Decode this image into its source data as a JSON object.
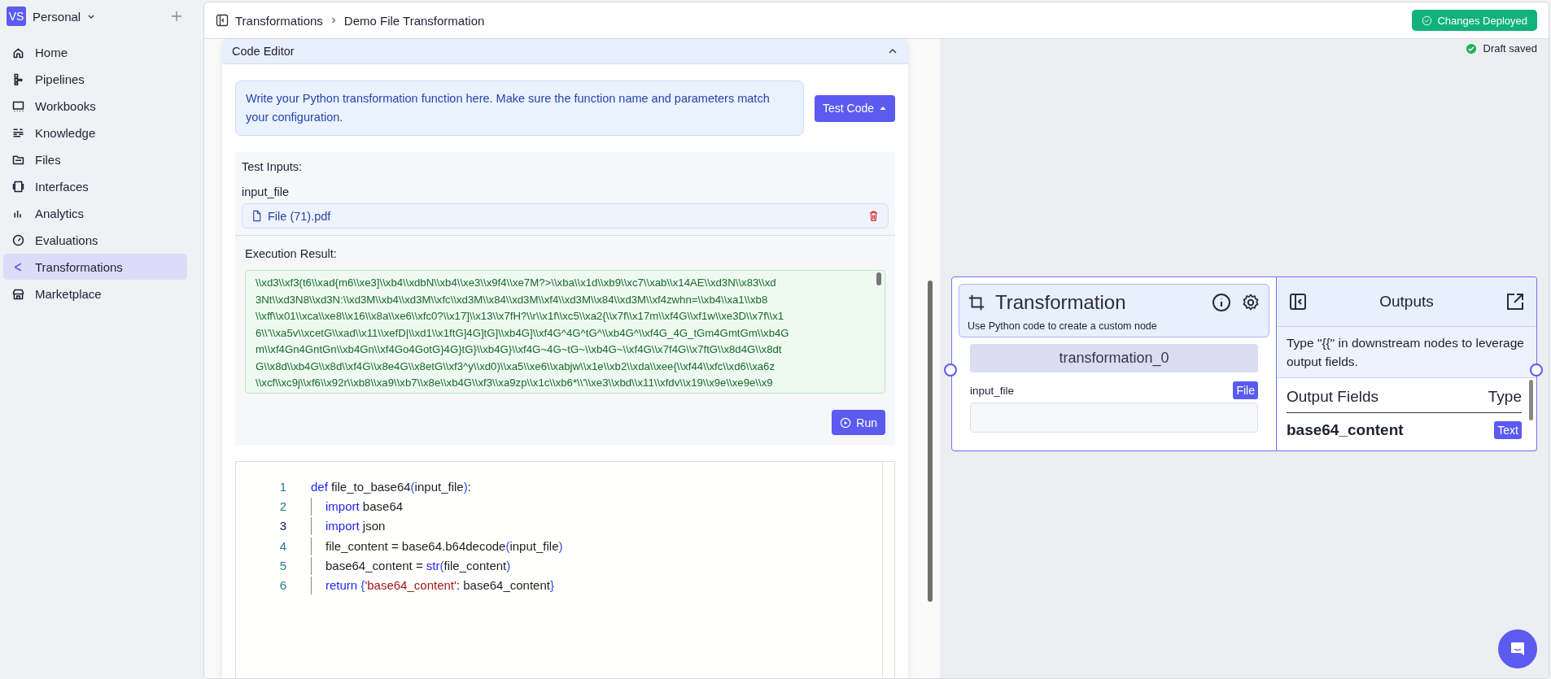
{
  "workspace": {
    "initials": "VS",
    "name": "Personal"
  },
  "sidebar": {
    "items": [
      {
        "label": "Home",
        "selected": false
      },
      {
        "label": "Pipelines",
        "selected": false
      },
      {
        "label": "Workbooks",
        "selected": false
      },
      {
        "label": "Knowledge",
        "selected": false
      },
      {
        "label": "Files",
        "selected": false
      },
      {
        "label": "Interfaces",
        "selected": false
      },
      {
        "label": "Analytics",
        "selected": false
      },
      {
        "label": "Evaluations",
        "selected": false
      },
      {
        "label": "Transformations",
        "selected": true
      },
      {
        "label": "Marketplace",
        "selected": false
      }
    ]
  },
  "breadcrumb": [
    "Transformations",
    "Demo File Transformation"
  ],
  "deploy_button": "Changes Deployed",
  "draft_status": "Draft saved",
  "code_editor": {
    "title": "Code Editor",
    "expanded": true,
    "info": "Write your Python transformation function here. Make sure the function name and parameters match your configuration.",
    "test_button": "Test Code",
    "test_inputs": {
      "title": "Test Inputs:",
      "field_label": "input_file",
      "file_name": "File (71).pdf"
    },
    "result": {
      "title": "Execution Result:",
      "lines": [
        "\\\\xd3\\\\xf3(t6\\\\xad{m6\\\\xe3]\\\\xb4\\\\xdbN\\\\xb4\\\\xe3\\\\x9f4\\\\xe7M?>\\\\xba\\\\x1d\\\\xb9\\\\xc7\\\\xab\\\\x14AE\\\\xd3N\\\\x83\\\\xd",
        "3Nt\\\\xd3N8\\\\xd3N:\\\\xd3M\\\\xb4\\\\xd3M\\\\xfc\\\\xd3M\\\\x84\\\\xd3M\\\\xf4\\\\xd3M\\\\x84\\\\xd3M\\\\xf4zwhn=\\\\xb4\\\\xa1\\\\xb8",
        "\\\\xff\\\\x01\\\\xca\\\\xe8\\\\x16\\\\x8a\\\\xe6\\\\xfc0?\\\\x17]\\\\x13\\\\x7fH?\\\\r\\\\x1f\\\\xc5\\\\xa2{\\\\x7f\\\\x17m\\\\xf4G\\\\xf1w\\\\xe3D\\\\x7f\\\\x1",
        "6\\\\'\\\\xa5v\\\\xcetG\\\\xad\\\\x11\\\\xefD|\\\\xd1\\\\x1ftG]4G]tG]\\\\xb4G]\\\\xf4G^4G^tG^\\\\xb4G^\\\\xf4G_4G_tGm4GmtGm\\\\xb4G",
        "m\\\\xf4Gn4GntGn\\\\xb4Gn\\\\xf4Go4GotG}4G}tG}\\\\xb4G}\\\\xf4G~4G~tG~\\\\xb4G~\\\\xf4G\\\\x7f4G\\\\x7ftG\\\\x8d4G\\\\x8dt",
        "G\\\\x8d\\\\xb4G\\\\x8d\\\\xf4G\\\\x8e4G\\\\x8etG\\\\xf3^y\\\\xd0)\\\\xa5\\\\xe6\\\\xabjw\\\\x1e\\\\xb2\\\\xda\\\\xee{\\\\xf44\\\\xfc\\\\xd6\\\\xa6z",
        "\\\\xcf\\\\xc9j\\\\xf6\\\\x92r\\\\xb8\\\\xa9\\\\xb7\\\\x8e\\\\xb4G\\\\xf3\\\\xa9zp\\\\x1c\\\\xb6*\\\\'\\\\xe3\\\\xbd\\\\x11\\\\xfdv\\\\x19\\\\x9e\\\\xe9e\\\\x9"
      ]
    },
    "run_button": "Run",
    "code": {
      "lines": [
        {
          "number": "1",
          "current": false,
          "tokens": [
            {
              "text": "def",
              "kind": "keyword"
            },
            {
              "text": " file_to_base64",
              "kind": "text"
            },
            {
              "text": "(",
              "kind": "bracket"
            },
            {
              "text": "input_file",
              "kind": "text"
            },
            {
              "text": ")",
              "kind": "bracket"
            },
            {
              "text": ":",
              "kind": "text"
            }
          ],
          "children": [
            {
              "number": "2",
              "current": false,
              "tokens": [
                {
                  "text": "import",
                  "kind": "keyword"
                },
                {
                  "text": " base64",
                  "kind": "text"
                }
              ]
            },
            {
              "number": "3",
              "current": true,
              "tokens": [
                {
                  "text": "import",
                  "kind": "keyword"
                },
                {
                  "text": " json",
                  "kind": "text"
                }
              ]
            },
            {
              "number": "4",
              "current": false,
              "tokens": [
                {
                  "text": "file_content = base64.b64decode",
                  "kind": "text"
                },
                {
                  "text": "(",
                  "kind": "bracket"
                },
                {
                  "text": "input_file",
                  "kind": "text"
                },
                {
                  "text": ")",
                  "kind": "bracket"
                }
              ]
            },
            {
              "number": "5",
              "current": false,
              "tokens": [
                {
                  "text": "base64_content = ",
                  "kind": "text"
                },
                {
                  "text": "str",
                  "kind": "keyword"
                },
                {
                  "text": "(",
                  "kind": "bracket"
                },
                {
                  "text": "file_content",
                  "kind": "text"
                },
                {
                  "text": ")",
                  "kind": "bracket"
                }
              ]
            },
            {
              "number": "6",
              "current": false,
              "tokens": [
                {
                  "text": "return",
                  "kind": "keyword"
                },
                {
                  "text": " {",
                  "kind": "bracket"
                },
                {
                  "text": "'base64_content'",
                  "kind": "string"
                },
                {
                  "text": ": base64_content",
                  "kind": "text"
                },
                {
                  "text": "}",
                  "kind": "bracket"
                }
              ]
            }
          ]
        }
      ]
    }
  },
  "node": {
    "title": "Transformation",
    "description": "Use Python code to create a custom node",
    "name": "transformation_0",
    "inputs": [
      {
        "label": "input_file",
        "type": "File"
      }
    ]
  },
  "outputs": {
    "title": "Outputs",
    "hint": "Type \"{{\" in downstream nodes to leverage output fields.",
    "fields_heading": "Output Fields",
    "type_heading": "Type",
    "fields": [
      {
        "name": "base64_content",
        "type": "Text"
      }
    ]
  }
}
